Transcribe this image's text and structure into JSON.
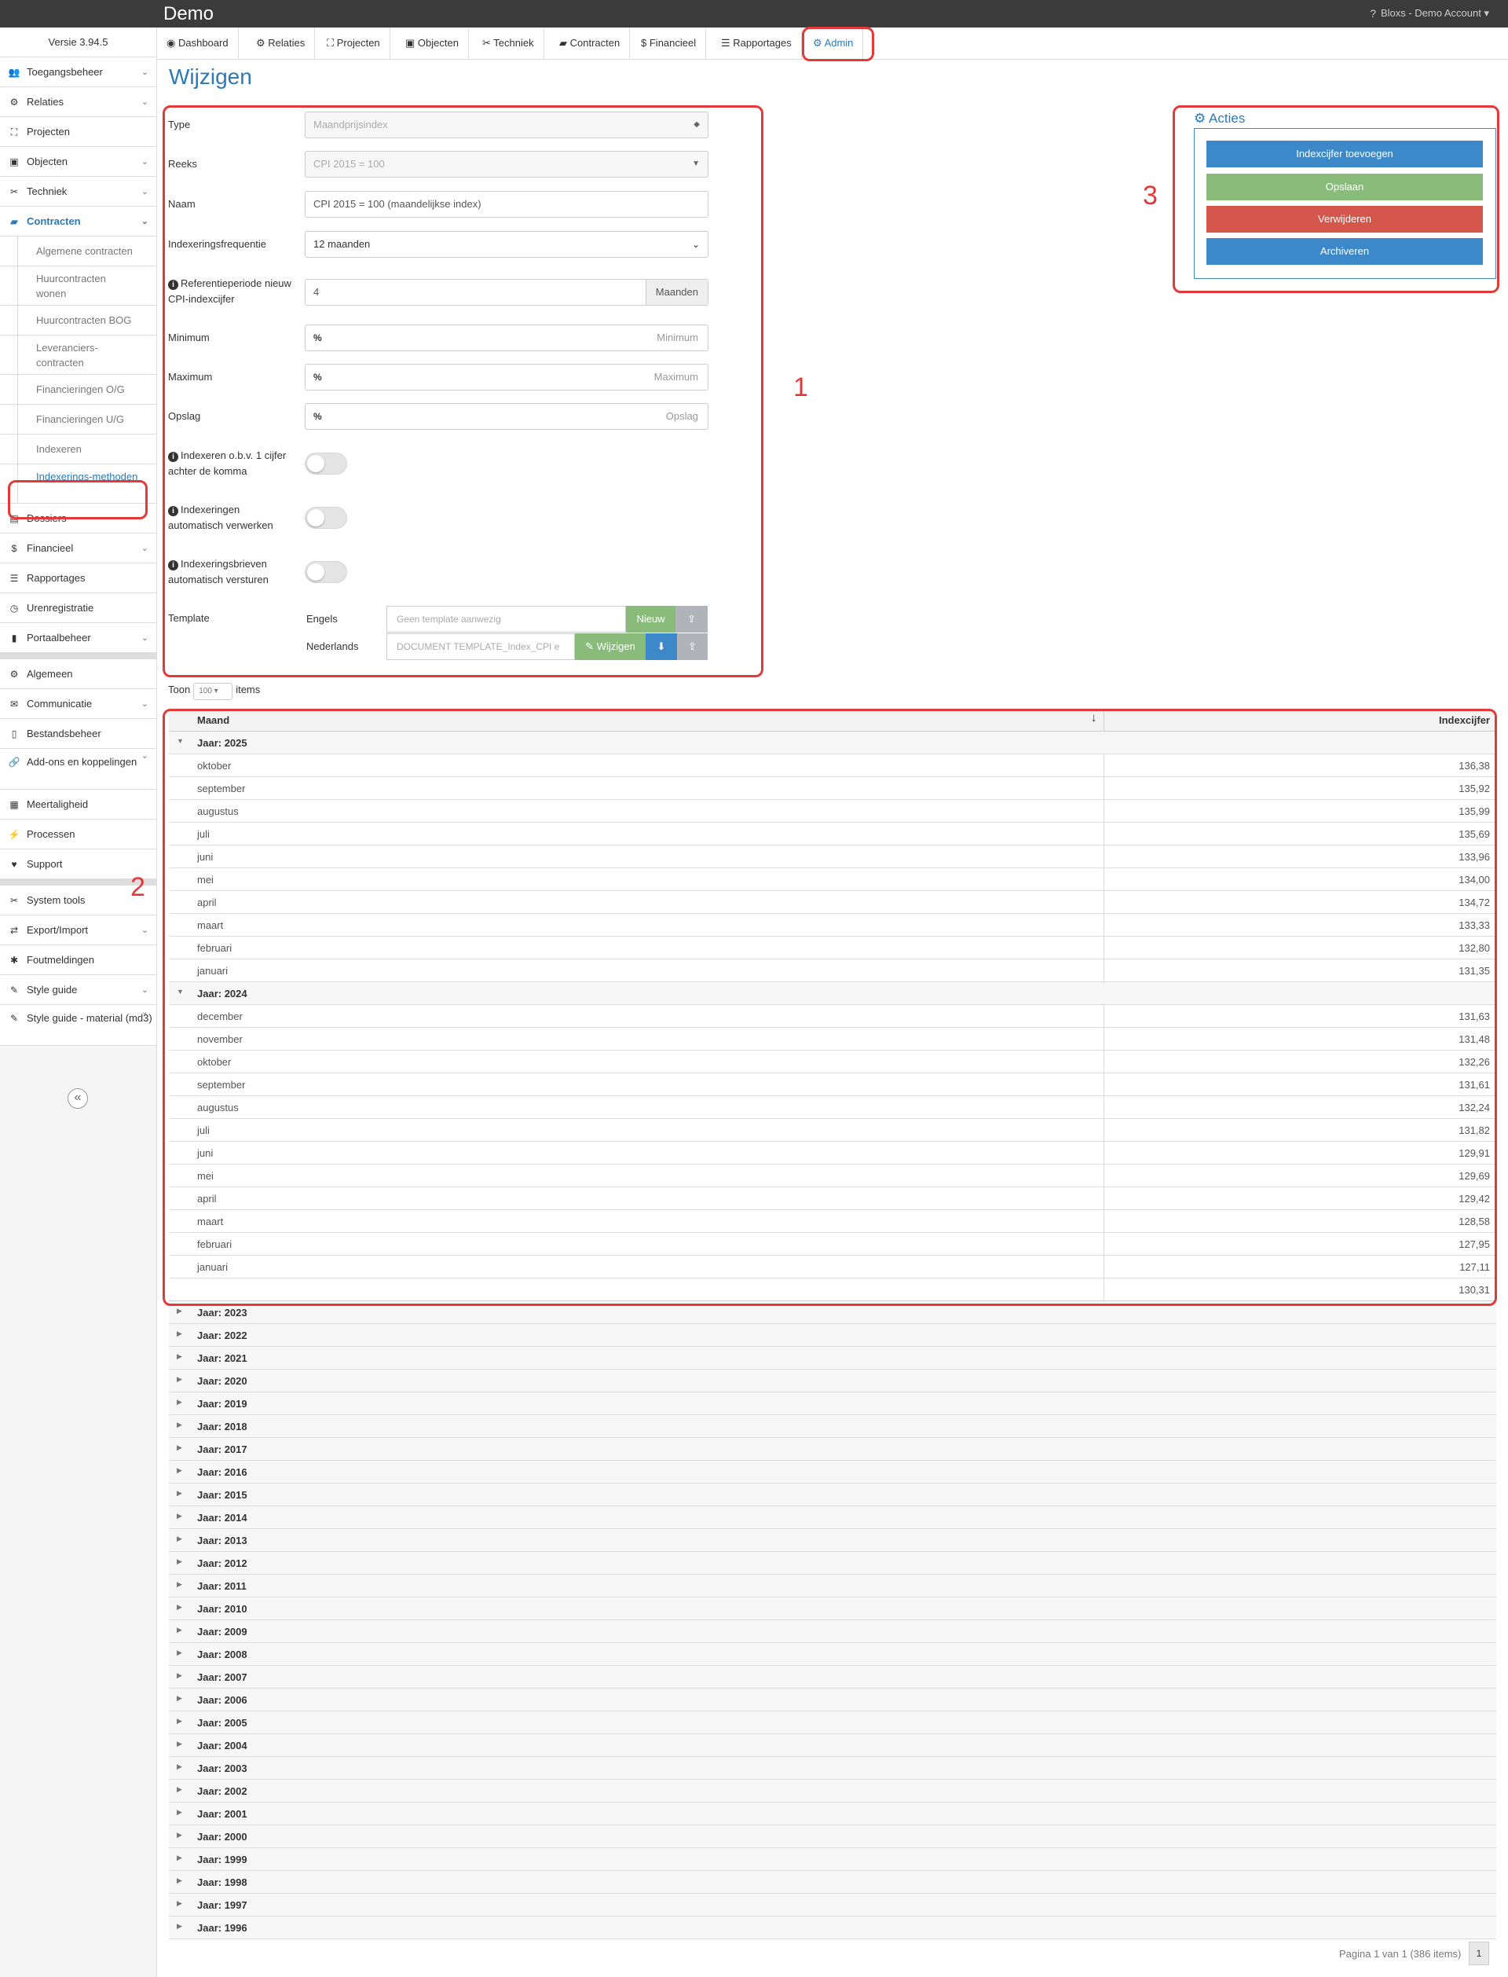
{
  "topbar": {
    "brand": "Demo",
    "help": "?",
    "account": "Bloxs - Demo Account",
    "account_caret": "▾"
  },
  "sidebar": {
    "version": "Versie 3.94.5",
    "items_a": [
      {
        "label": "Toegangsbeheer",
        "icon": "👥",
        "chev": true
      },
      {
        "label": "Relaties",
        "icon": "⚙",
        "chev": true
      },
      {
        "label": "Projecten",
        "icon": "⛶",
        "chev": false
      },
      {
        "label": "Objecten",
        "icon": "▣",
        "chev": true
      },
      {
        "label": "Techniek",
        "icon": "✂",
        "chev": true
      },
      {
        "label": "Contracten",
        "icon": "▰",
        "chev": true,
        "active": true
      }
    ],
    "subitems": [
      {
        "label": "Algemene contracten",
        "two": false
      },
      {
        "label": "Huurcontracten wonen",
        "two": true
      },
      {
        "label": "Huurcontracten BOG",
        "two": false
      },
      {
        "label": "Leveranciers-contracten",
        "two": true
      },
      {
        "label": "Financieringen O/G",
        "two": false
      },
      {
        "label": "Financieringen U/G",
        "two": false
      },
      {
        "label": "Indexeren",
        "two": false
      },
      {
        "label": "Indexerings-methoden",
        "two": true,
        "selected": true
      }
    ],
    "items_b": [
      {
        "label": "Dossiers",
        "icon": "▤",
        "chev": false
      },
      {
        "label": "Financieel",
        "icon": "$",
        "chev": true
      },
      {
        "label": "Rapportages",
        "icon": "☰",
        "chev": false
      },
      {
        "label": "Urenregistratie",
        "icon": "◷",
        "chev": false
      },
      {
        "label": "Portaalbeheer",
        "icon": "▮",
        "chev": true
      }
    ],
    "items_c": [
      {
        "label": "Algemeen",
        "icon": "⚙",
        "chev": false
      },
      {
        "label": "Communicatie",
        "icon": "✉",
        "chev": true
      },
      {
        "label": "Bestandsbeheer",
        "icon": "▯",
        "chev": false
      },
      {
        "label": "Add-ons en koppelingen",
        "icon": "🔗",
        "chev": true,
        "two": true
      },
      {
        "label": "Meertaligheid",
        "icon": "▦",
        "chev": false
      },
      {
        "label": "Processen",
        "icon": "⚡",
        "chev": false
      },
      {
        "label": "Support",
        "icon": "♥",
        "chev": false
      }
    ],
    "items_d": [
      {
        "label": "System tools",
        "icon": "✂",
        "chev": false
      },
      {
        "label": "Export/Import",
        "icon": "⇄",
        "chev": true
      },
      {
        "label": "Foutmeldingen",
        "icon": "✱",
        "chev": false
      },
      {
        "label": "Style guide",
        "icon": "✎",
        "chev": true
      },
      {
        "label": "Style guide - material (md3)",
        "icon": "✎",
        "chev": true,
        "two": true
      }
    ],
    "collapse_icon": "«"
  },
  "tabs": [
    {
      "label": "Dashboard",
      "icon": "◉"
    },
    {
      "label": "Relaties",
      "icon": "⚙"
    },
    {
      "label": "Projecten",
      "icon": "⛶"
    },
    {
      "label": "Objecten",
      "icon": "▣"
    },
    {
      "label": "Techniek",
      "icon": "✂"
    },
    {
      "label": "Contracten",
      "icon": "▰"
    },
    {
      "label": "Financieel",
      "icon": "$"
    },
    {
      "label": "Rapportages",
      "icon": "☰"
    },
    {
      "label": "Admin",
      "icon": "⚙",
      "active": true
    }
  ],
  "page_title": "Wijzigen",
  "form": {
    "type_label": "Type",
    "type_value": "Maandprijsindex",
    "reeks_label": "Reeks",
    "reeks_value": "CPI 2015 = 100",
    "naam_label": "Naam",
    "naam_value": "CPI 2015 = 100 (maandelijkse index)",
    "freq_label": "Indexeringsfrequentie",
    "freq_value": "12 maanden",
    "ref_label": "Referentieperiode nieuw CPI-indexcijfer",
    "ref_value": "4",
    "ref_addon": "Maanden",
    "min_label": "Minimum",
    "min_placeholder": "Minimum",
    "max_label": "Maximum",
    "max_placeholder": "Maximum",
    "opslag_label": "Opslag",
    "opslag_placeholder": "Opslag",
    "pct_symbol": "%",
    "toggle1_label": "Indexeren o.b.v. 1 cijfer achter de komma",
    "toggle2_label": "Indexeringen automatisch verwerken",
    "toggle3_label": "Indexeringsbrieven automatisch versturen",
    "template_label": "Template",
    "engels_label": "Engels",
    "engels_placeholder": "Geen template aanwezig",
    "nieuw_btn": "Nieuw",
    "nl_label": "Nederlands",
    "nl_value": "DOCUMENT TEMPLATE_Index_CPI e",
    "wijzigen_btn": "Wijzigen",
    "upload_icon": "⇪",
    "download_icon": "⬇",
    "edit_icon": "✎",
    "info_icon": "i"
  },
  "toon": {
    "before": "Toon",
    "value": "100",
    "after": "items"
  },
  "grid": {
    "col1": "Maand",
    "col2": "Indexcijfer",
    "sort_icon": "↓",
    "groups_expanded": [
      {
        "label": "Jaar: 2025",
        "rows": [
          [
            "oktober",
            "136,38"
          ],
          [
            "september",
            "135,92"
          ],
          [
            "augustus",
            "135,99"
          ],
          [
            "juli",
            "135,69"
          ],
          [
            "juni",
            "133,96"
          ],
          [
            "mei",
            "134,00"
          ],
          [
            "april",
            "134,72"
          ],
          [
            "maart",
            "133,33"
          ],
          [
            "februari",
            "132,80"
          ],
          [
            "januari",
            "131,35"
          ]
        ]
      },
      {
        "label": "Jaar: 2024",
        "rows": [
          [
            "december",
            "131,63"
          ],
          [
            "november",
            "131,48"
          ],
          [
            "oktober",
            "132,26"
          ],
          [
            "september",
            "131,61"
          ],
          [
            "augustus",
            "132,24"
          ],
          [
            "juli",
            "131,82"
          ],
          [
            "juni",
            "129,91"
          ],
          [
            "mei",
            "129,69"
          ],
          [
            "april",
            "129,42"
          ],
          [
            "maart",
            "128,58"
          ],
          [
            "februari",
            "127,95"
          ],
          [
            "januari",
            "127,11"
          ]
        ]
      }
    ],
    "footer_value": "130,31",
    "groups_collapsed": [
      "Jaar: 2023",
      "Jaar: 2022",
      "Jaar: 2021",
      "Jaar: 2020",
      "Jaar: 2019",
      "Jaar: 2018",
      "Jaar: 2017",
      "Jaar: 2016",
      "Jaar: 2015",
      "Jaar: 2014",
      "Jaar: 2013",
      "Jaar: 2012",
      "Jaar: 2011",
      "Jaar: 2010",
      "Jaar: 2009",
      "Jaar: 2008",
      "Jaar: 2007",
      "Jaar: 2006",
      "Jaar: 2005",
      "Jaar: 2004",
      "Jaar: 2003",
      "Jaar: 2002",
      "Jaar: 2001",
      "Jaar: 2000",
      "Jaar: 1999",
      "Jaar: 1998",
      "Jaar: 1997",
      "Jaar: 1996"
    ]
  },
  "pager": {
    "text": "Pagina 1 van 1 (386 items)",
    "page": "1"
  },
  "acties": {
    "title": "Acties",
    "icon": "⚙",
    "buttons": [
      "Indexcijfer toevoegen",
      "Opslaan",
      "Verwijderen",
      "Archiveren"
    ]
  },
  "annotations": [
    "1",
    "2",
    "3"
  ],
  "colors": {
    "accent": "#2a7ab9",
    "annotation": "#e23a3a",
    "green": "#89bb7b",
    "blue": "#3c88c8",
    "red": "#d5574b"
  }
}
